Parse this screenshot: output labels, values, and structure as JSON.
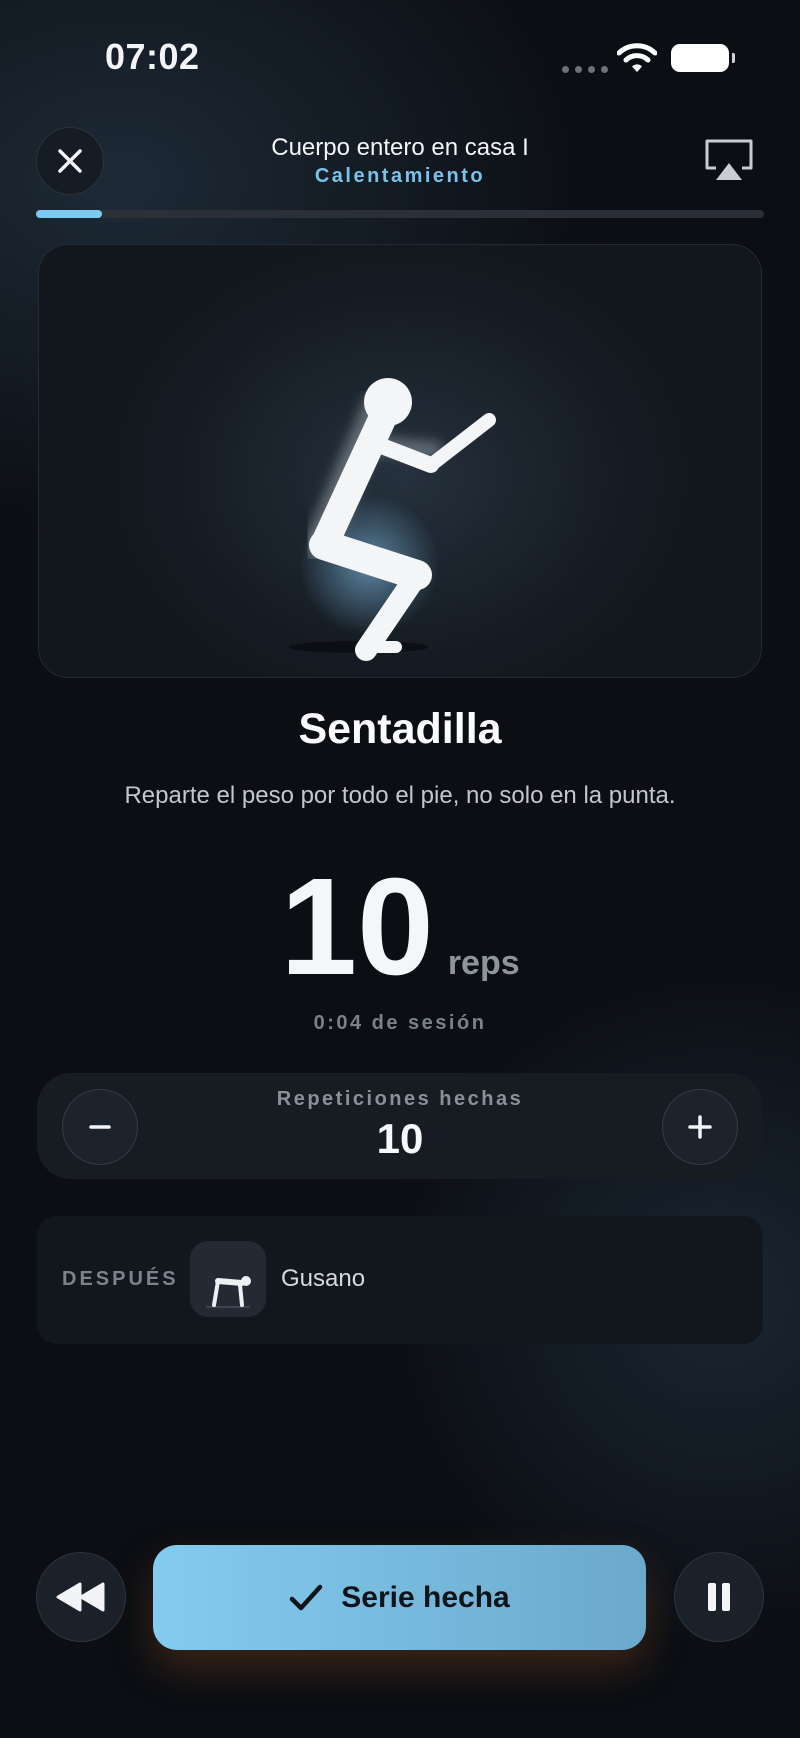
{
  "status_bar": {
    "time": "07:02"
  },
  "header": {
    "title": "Cuerpo entero en casa I",
    "subtitle": "Calentamiento"
  },
  "workout_progress": 0.09,
  "exercise": {
    "name": "Sentadilla",
    "tip": "Reparte el peso por todo el pie, no solo en la punta.",
    "target_reps": "10",
    "reps_unit": "reps",
    "session_time": "0:04 de sesión"
  },
  "counter": {
    "label": "Repeticiones hechas",
    "value": "10"
  },
  "next": {
    "label": "DESPUÉS",
    "name": "Gusano"
  },
  "controls": {
    "done_label": "Serie hecha"
  },
  "colors": {
    "accent": "#7ccaf0",
    "background": "#0b0e13"
  }
}
